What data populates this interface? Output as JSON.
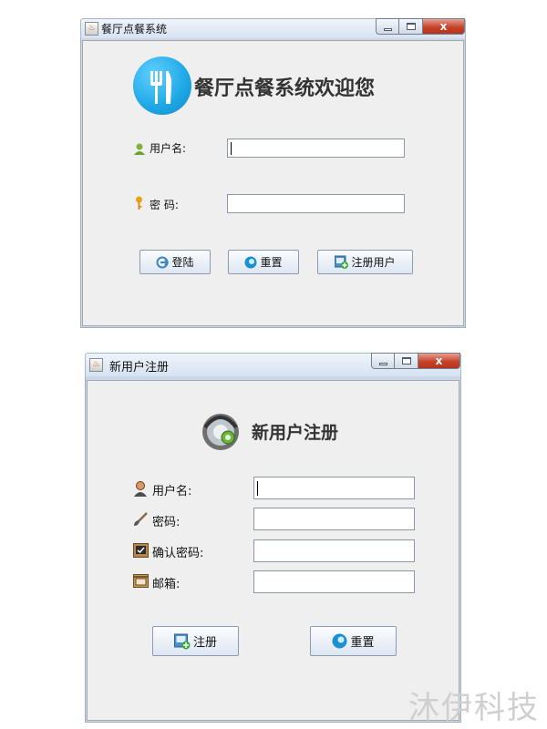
{
  "login_window": {
    "title": "餐厅点餐系统",
    "close_glyph": "x",
    "heading": "餐厅点餐系统欢迎您",
    "logo_icon": "fork-knife-icon",
    "username_label": "用户名:",
    "username_value": "",
    "password_label": "密 码:",
    "password_value": "",
    "buttons": {
      "login": "登陆",
      "reset": "重置",
      "register": "注册用户"
    }
  },
  "register_window": {
    "title": "新用户注册",
    "close_glyph": "x",
    "heading": "新用户注册",
    "fields": {
      "username_label": "用户名:",
      "password_label": "密码:",
      "confirm_label": "确认密码:",
      "email_label": "邮箱:"
    },
    "buttons": {
      "register": "注册",
      "reset": "重置"
    }
  },
  "watermark": "沐伊科技",
  "colors": {
    "accent_logo": "#1da7e6",
    "close_button": "#c4432a"
  }
}
